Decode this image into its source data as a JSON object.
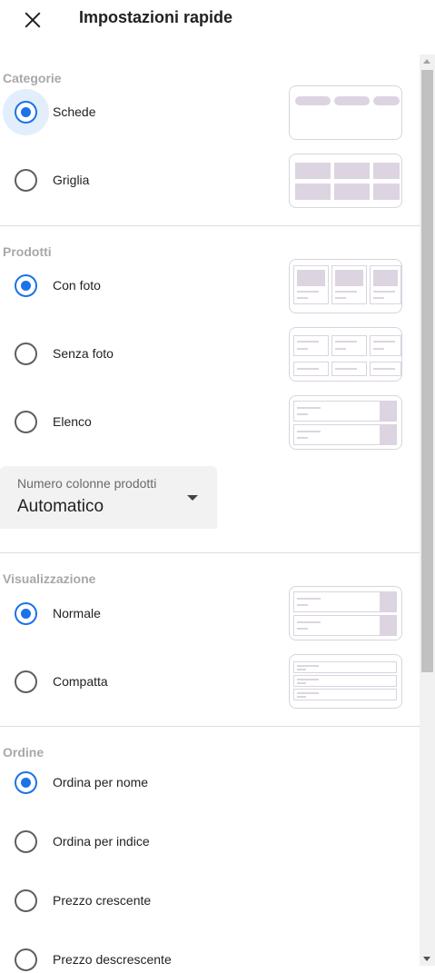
{
  "header": {
    "title": "Impostazioni rapide",
    "close_icon": "close-icon"
  },
  "categories": {
    "title": "Categorie",
    "options": [
      {
        "label": "Schede",
        "checked": true,
        "preview": "cards-preview"
      },
      {
        "label": "Griglia",
        "checked": false,
        "preview": "grid-preview"
      }
    ]
  },
  "products": {
    "title": "Prodotti",
    "options": [
      {
        "label": "Con foto",
        "checked": true,
        "preview": "with-photo-preview"
      },
      {
        "label": "Senza foto",
        "checked": false,
        "preview": "without-photo-preview"
      },
      {
        "label": "Elenco",
        "checked": false,
        "preview": "list-preview"
      }
    ],
    "columns_select": {
      "label": "Numero colonne prodotti",
      "value": "Automatico"
    }
  },
  "display": {
    "title": "Visualizzazione",
    "options": [
      {
        "label": "Normale",
        "checked": true,
        "preview": "normal-preview"
      },
      {
        "label": "Compatta",
        "checked": false,
        "preview": "compact-preview"
      }
    ]
  },
  "order": {
    "title": "Ordine",
    "options": [
      {
        "label": "Ordina per nome",
        "checked": true
      },
      {
        "label": "Ordina per indice",
        "checked": false
      },
      {
        "label": "Prezzo crescente",
        "checked": false
      },
      {
        "label": "Prezzo descrescente",
        "checked": false
      }
    ]
  },
  "colors": {
    "accent": "#1a73e8",
    "section_title": "#a8a8a8",
    "preview_fill": "#ddd4e1"
  }
}
